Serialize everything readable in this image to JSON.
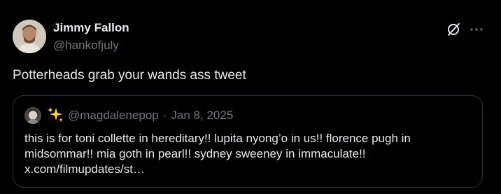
{
  "author": {
    "display_name": "Jimmy Fallon",
    "handle": "@hankofjuly",
    "avatar_icon": "avatar-photo"
  },
  "actions": {
    "grok_icon": "grok-slash-circle-icon",
    "more_icon": "more-dots-icon"
  },
  "tweet": {
    "text": "Potterheads grab your wands ass tweet"
  },
  "quote": {
    "emoji": "✨",
    "handle": "@magdalenepop",
    "separator": "·",
    "date": "Jan 8, 2025",
    "lines": [
      "this is for toni collette in hereditary!! lupita nyong’o in us!! florence pugh in",
      "midsommar!! mia goth in pearl!! sydney sweeney in immaculate!!"
    ],
    "link": "x.com/filmupdates/st…"
  },
  "colors": {
    "background": "#000000",
    "text": "#e7e9ea",
    "muted": "#71767b",
    "border": "#2f3336",
    "sparkle": "#ffcc4d"
  }
}
